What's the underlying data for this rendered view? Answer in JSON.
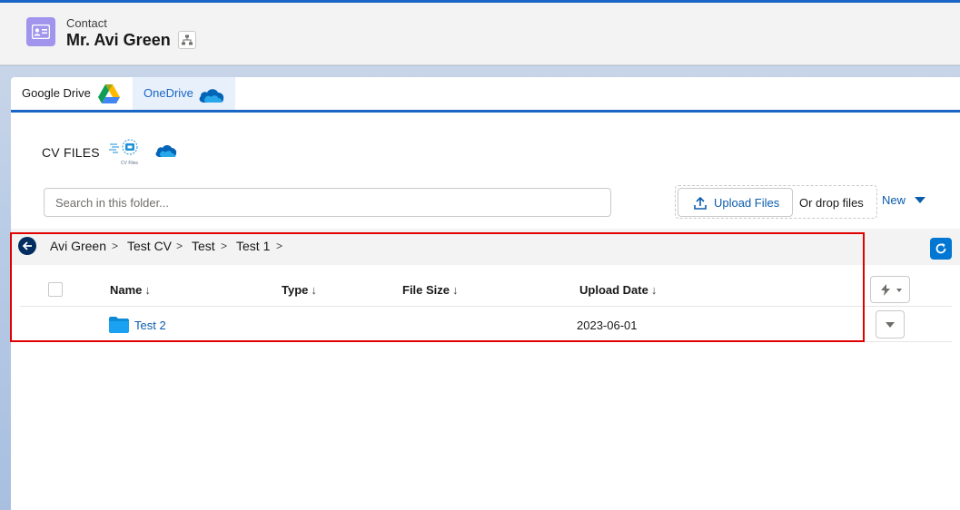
{
  "record": {
    "type_label": "Contact",
    "name": "Mr. Avi Green"
  },
  "tabs": [
    {
      "label": "Google Drive",
      "icon": "google-drive-icon"
    },
    {
      "label": "OneDrive",
      "icon": "onedrive-icon",
      "active": true
    }
  ],
  "section": {
    "title": "CV FILES",
    "logo_caption": "CV Files"
  },
  "search": {
    "placeholder": "Search in this folder..."
  },
  "upload": {
    "button_label": "Upload Files",
    "drop_label": "Or drop files"
  },
  "new_button": {
    "label": "New"
  },
  "breadcrumb": {
    "items": [
      "Avi Green",
      "Test CV",
      "Test",
      "Test 1"
    ],
    "separator": ">"
  },
  "table": {
    "columns": [
      {
        "label": "Name",
        "sort": "↓"
      },
      {
        "label": "Type",
        "sort": "↓"
      },
      {
        "label": "File Size",
        "sort": "↓"
      },
      {
        "label": "Upload Date",
        "sort": "↓"
      }
    ],
    "rows": [
      {
        "name": "Test 2",
        "type": "",
        "file_size": "",
        "upload_date": "2023-06-01",
        "icon": "folder-icon"
      }
    ]
  },
  "colors": {
    "brand_blue": "#1b65c5",
    "link_blue": "#0b5cab",
    "contact_icon_bg": "#a094ed",
    "highlight_red": "#e00000"
  }
}
